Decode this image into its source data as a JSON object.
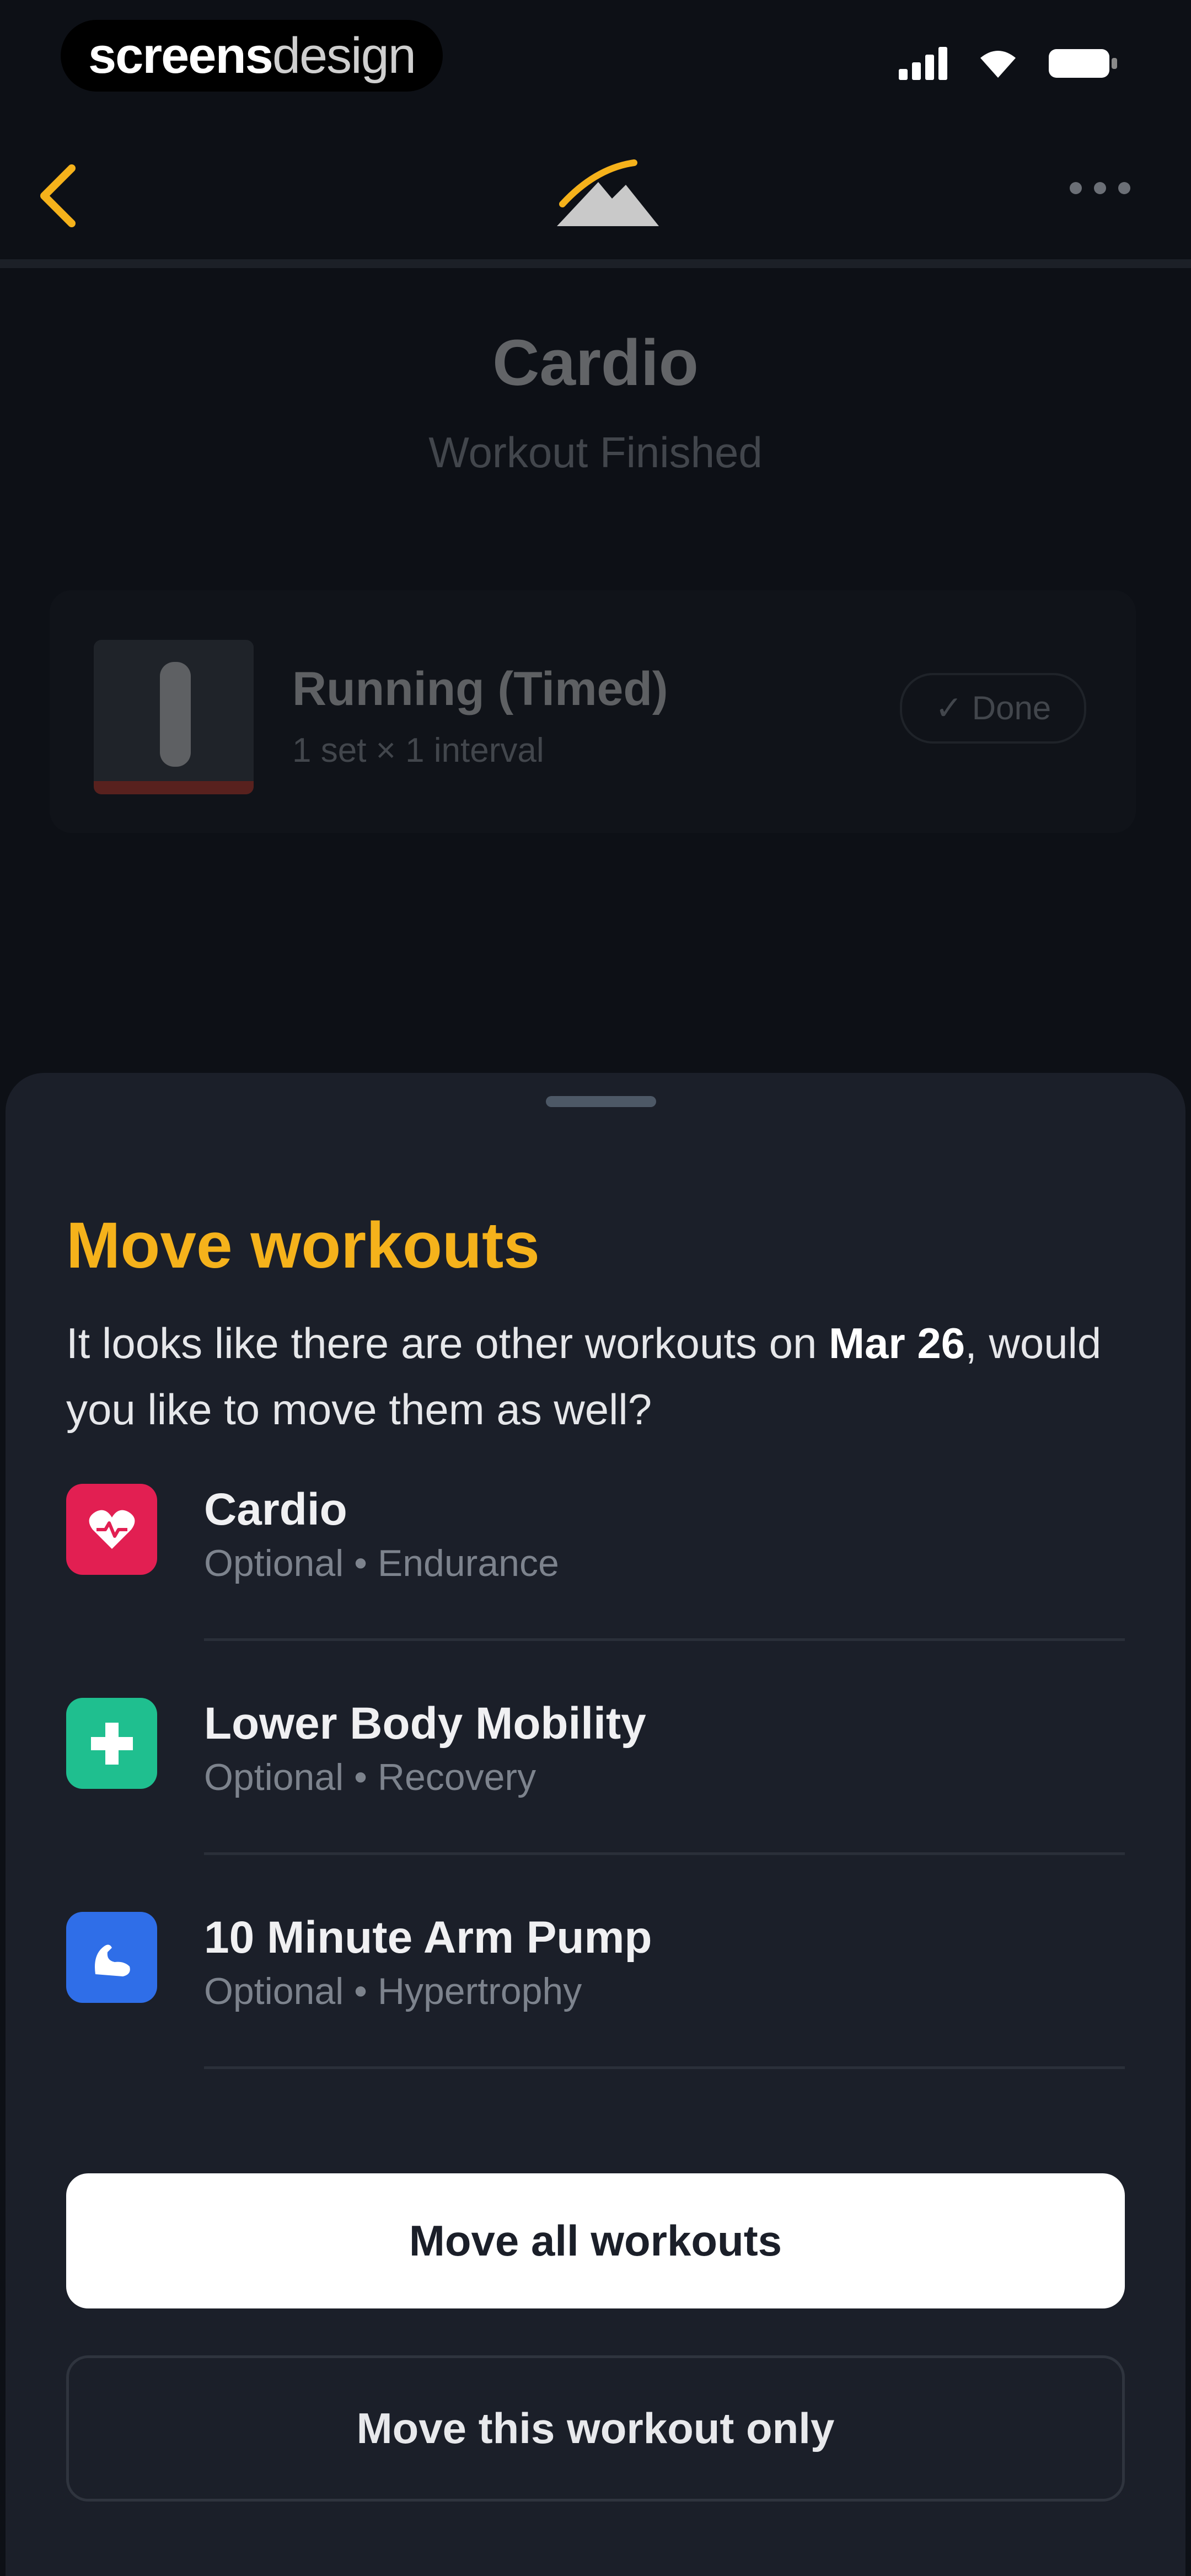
{
  "status_bar": {
    "watermark_bold": "screens",
    "watermark_light": "design",
    "icons": [
      "signal-icon",
      "wifi-icon",
      "battery-icon"
    ]
  },
  "nav": {
    "back_icon": "chevron-left-icon",
    "logo_icon": "mountain-logo-icon",
    "more_icon": "more-horizontal-icon",
    "accent": "#f5b21b"
  },
  "background_screen": {
    "title": "Cardio",
    "subtitle": "Workout Finished",
    "exercise": {
      "name": "Running (Timed)",
      "meta": "1 set × 1 interval",
      "status": "✓ Done"
    }
  },
  "sheet": {
    "title": "Move workouts",
    "desc_prefix": "It looks like there are other workouts on ",
    "desc_date": "Mar 26",
    "desc_suffix": ", would you like to move them as well?",
    "workouts": [
      {
        "name": "Cardio",
        "meta": "Optional • Endurance",
        "icon": "heart-icon",
        "color": "#e21f52"
      },
      {
        "name": "Lower Body Mobility",
        "meta": "Optional • Recovery",
        "icon": "plus-cross-icon",
        "color": "#1fbf8f"
      },
      {
        "name": "10 Minute Arm Pump",
        "meta": "Optional • Hypertrophy",
        "icon": "flexed-arm-icon",
        "color": "#2f6ee8"
      }
    ],
    "primary_button": "Move all workouts",
    "secondary_button": "Move this workout only"
  }
}
